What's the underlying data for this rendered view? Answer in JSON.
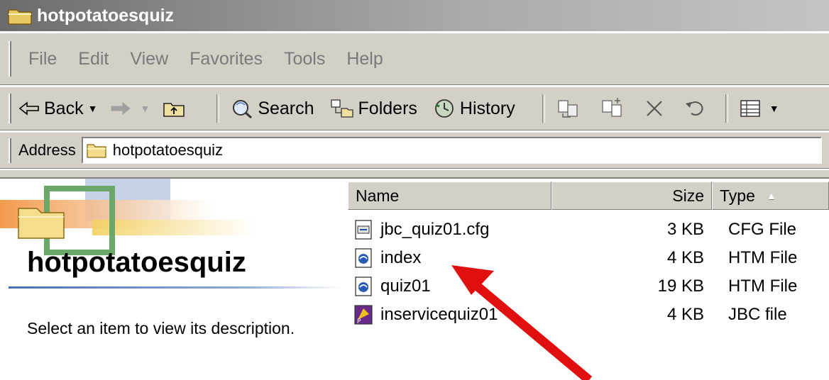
{
  "window": {
    "title": "hotpotatoesquiz"
  },
  "menu": {
    "items": [
      "File",
      "Edit",
      "View",
      "Favorites",
      "Tools",
      "Help"
    ]
  },
  "toolbar": {
    "back_label": "Back",
    "search_label": "Search",
    "folders_label": "Folders",
    "history_label": "History"
  },
  "address": {
    "label": "Address",
    "value": "hotpotatoesquiz"
  },
  "left_pane": {
    "folder_title": "hotpotatoesquiz",
    "description": "Select an item to view its description."
  },
  "file_list": {
    "columns": {
      "name": "Name",
      "size": "Size",
      "type": "Type"
    },
    "sort_column": "Type",
    "files": [
      {
        "name": "jbc_quiz01.cfg",
        "size": "3 KB",
        "type": "CFG File",
        "icon": "cfg-file-icon"
      },
      {
        "name": "index",
        "size": "4 KB",
        "type": "HTM File",
        "icon": "htm-file-icon"
      },
      {
        "name": "quiz01",
        "size": "19 KB",
        "type": "HTM File",
        "icon": "htm-file-icon"
      },
      {
        "name": "inservicequiz01",
        "size": "4 KB",
        "type": "JBC file",
        "icon": "jbc-file-icon"
      }
    ]
  },
  "annotation": {
    "arrow_color": "#e01010"
  },
  "colors": {
    "chrome": "#d4d0c8",
    "title_gradient_start": "#6b6b6b",
    "accent_blue": "#4a6fb5"
  }
}
